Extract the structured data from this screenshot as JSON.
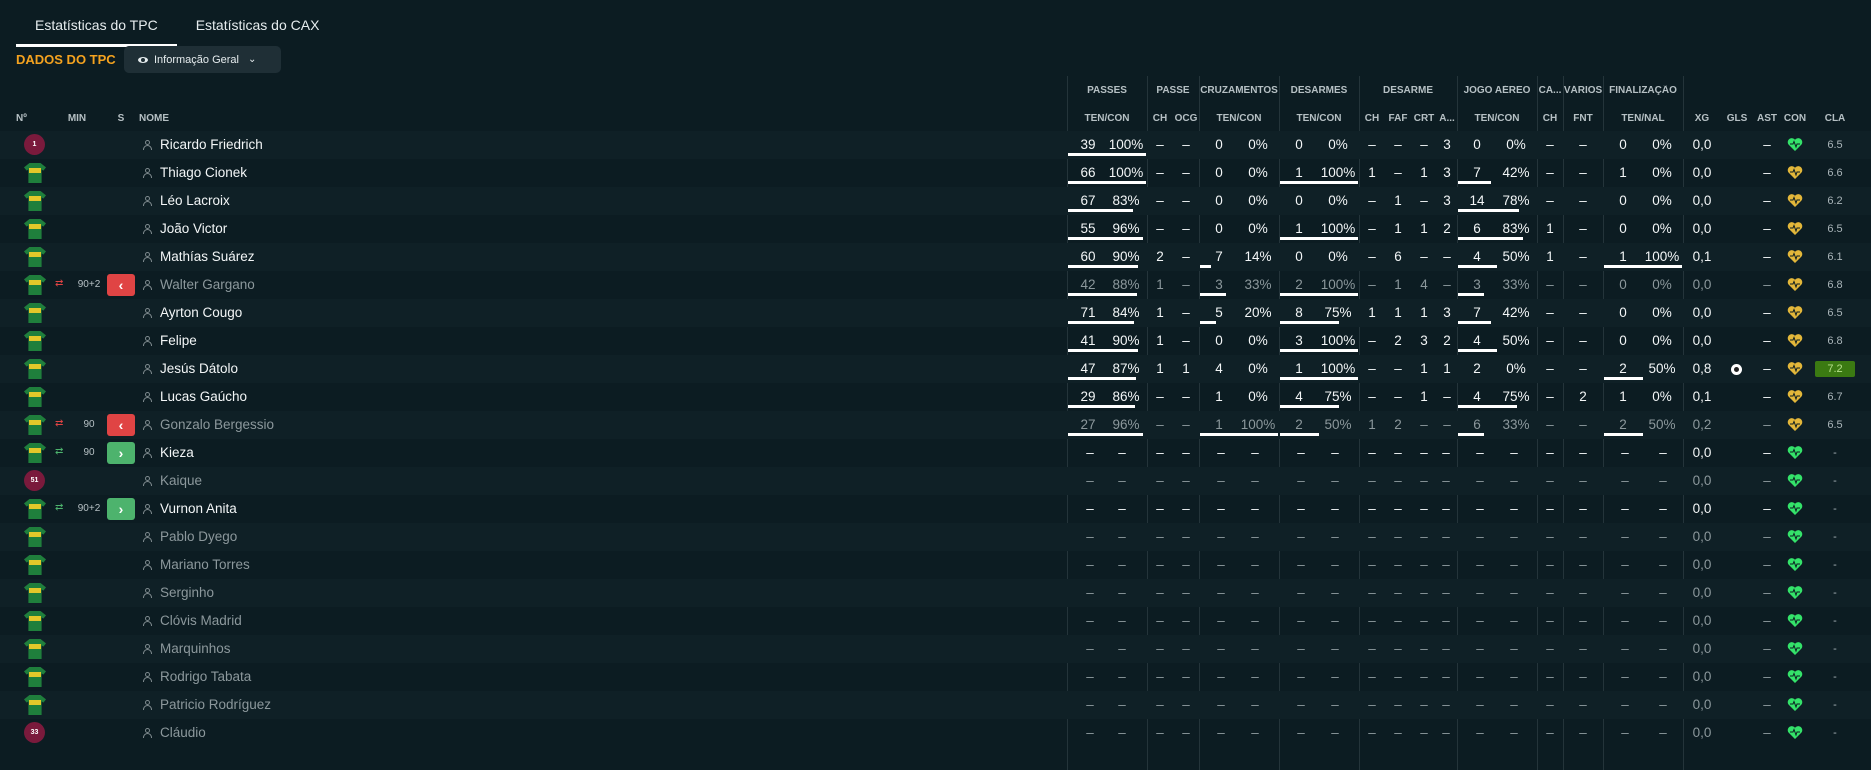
{
  "tabs": [
    {
      "label": "Estatísticas do TPC",
      "active": true
    },
    {
      "label": "Estatísticas do CAX",
      "active": false
    }
  ],
  "section_title": "DADOS DO TPC",
  "view_dropdown": {
    "label": "Informação Geral"
  },
  "groups": [
    "PASSES",
    "PASSE",
    "CRUZAMENTOS",
    "DESARMES",
    "DESARME",
    "JOGO AÉREO",
    "CA...",
    "VÁRIOS",
    "FINALIZAÇÃO"
  ],
  "headers": {
    "num": "Nº",
    "min": "MIN",
    "s": "S",
    "name": "NOME",
    "pass": "TEN/CON",
    "pass_ch": "CH",
    "pass_ocg": "OCG",
    "cross": "TEN/CON",
    "tackle": "TEN/CON",
    "tk_ch": "CH",
    "tk_faf": "FAF",
    "tk_crt": "CRT",
    "tk_a": "A...",
    "air": "TEN/CON",
    "ca_ch": "CH",
    "var_fnt": "FNT",
    "fin": "TEN/NAL",
    "xg": "XG",
    "gls": "GLS",
    "ast": "AST",
    "con": "CON",
    "cla": "CLA"
  },
  "colors": {
    "accent": "#f4a21f",
    "out": "#e04444",
    "in": "#4db36d",
    "heart_green": "#34e36a",
    "heart_gold": "#e3b73a"
  },
  "players": [
    {
      "name": "Ricardo Friedrich",
      "kit": "gk",
      "num": "1",
      "dim": false,
      "sub": null,
      "min": "",
      "pass": [
        "39",
        "100%"
      ],
      "pass_bar": 1.0,
      "pch": "–",
      "pocg": "–",
      "cross": [
        "0",
        "0%"
      ],
      "cross_bar": 0,
      "tack": [
        "0",
        "0%"
      ],
      "tack_bar": 0,
      "tk": [
        "–",
        "–",
        "–",
        "3"
      ],
      "air": [
        "0",
        "0%"
      ],
      "air_bar": 0,
      "cach": "–",
      "fnt": "–",
      "fin": [
        "0",
        "0%"
      ],
      "fin_bar": 0,
      "xg": "0,0",
      "gls": "",
      "ast": "–",
      "con": "green",
      "cla": "6.5",
      "cla_hi": false
    },
    {
      "name": "Thiago Cionek",
      "kit": "green",
      "num": "",
      "dim": false,
      "sub": null,
      "min": "",
      "pass": [
        "66",
        "100%"
      ],
      "pass_bar": 1.0,
      "pch": "–",
      "pocg": "–",
      "cross": [
        "0",
        "0%"
      ],
      "cross_bar": 0,
      "tack": [
        "1",
        "100%"
      ],
      "tack_bar": 1.0,
      "tk": [
        "1",
        "–",
        "1",
        "3"
      ],
      "air": [
        "7",
        "42%"
      ],
      "air_bar": 0.42,
      "cach": "–",
      "fnt": "–",
      "fin": [
        "1",
        "0%"
      ],
      "fin_bar": 0,
      "xg": "0,0",
      "gls": "",
      "ast": "–",
      "con": "gold",
      "cla": "6.6",
      "cla_hi": false
    },
    {
      "name": "Léo Lacroix",
      "kit": "green",
      "num": "",
      "dim": false,
      "sub": null,
      "min": "",
      "pass": [
        "67",
        "83%"
      ],
      "pass_bar": 0.83,
      "pch": "–",
      "pocg": "–",
      "cross": [
        "0",
        "0%"
      ],
      "cross_bar": 0,
      "tack": [
        "0",
        "0%"
      ],
      "tack_bar": 0,
      "tk": [
        "–",
        "1",
        "–",
        "3"
      ],
      "air": [
        "14",
        "78%"
      ],
      "air_bar": 0.78,
      "cach": "–",
      "fnt": "–",
      "fin": [
        "0",
        "0%"
      ],
      "fin_bar": 0,
      "xg": "0,0",
      "gls": "",
      "ast": "–",
      "con": "gold",
      "cla": "6.2",
      "cla_hi": false
    },
    {
      "name": "João Victor",
      "kit": "green",
      "num": "",
      "dim": false,
      "sub": null,
      "min": "",
      "pass": [
        "55",
        "96%"
      ],
      "pass_bar": 0.96,
      "pch": "–",
      "pocg": "–",
      "cross": [
        "0",
        "0%"
      ],
      "cross_bar": 0,
      "tack": [
        "1",
        "100%"
      ],
      "tack_bar": 1.0,
      "tk": [
        "–",
        "1",
        "1",
        "2"
      ],
      "air": [
        "6",
        "83%"
      ],
      "air_bar": 0.83,
      "cach": "1",
      "fnt": "–",
      "fin": [
        "0",
        "0%"
      ],
      "fin_bar": 0,
      "xg": "0,0",
      "gls": "",
      "ast": "–",
      "con": "gold",
      "cla": "6.5",
      "cla_hi": false
    },
    {
      "name": "Mathías Suárez",
      "kit": "green",
      "num": "",
      "dim": false,
      "sub": null,
      "min": "",
      "pass": [
        "60",
        "90%"
      ],
      "pass_bar": 0.9,
      "pch": "2",
      "pocg": "–",
      "cross": [
        "7",
        "14%"
      ],
      "cross_bar": 0.14,
      "tack": [
        "0",
        "0%"
      ],
      "tack_bar": 0,
      "tk": [
        "–",
        "6",
        "–",
        "–"
      ],
      "air": [
        "4",
        "50%"
      ],
      "air_bar": 0.5,
      "cach": "1",
      "fnt": "–",
      "fin": [
        "1",
        "100%"
      ],
      "fin_bar": 1.0,
      "xg": "0,1",
      "gls": "",
      "ast": "–",
      "con": "gold",
      "cla": "6.1",
      "cla_hi": false
    },
    {
      "name": "Walter Gargano",
      "kit": "green",
      "num": "",
      "dim": true,
      "sub": "out",
      "min": "90+2",
      "pass": [
        "42",
        "88%"
      ],
      "pass_bar": 0.88,
      "pch": "1",
      "pocg": "–",
      "cross": [
        "3",
        "33%"
      ],
      "cross_bar": 0.33,
      "tack": [
        "2",
        "100%"
      ],
      "tack_bar": 1.0,
      "tk": [
        "–",
        "1",
        "4",
        "–"
      ],
      "air": [
        "3",
        "33%"
      ],
      "air_bar": 0.33,
      "cach": "–",
      "fnt": "–",
      "fin": [
        "0",
        "0%"
      ],
      "fin_bar": 0,
      "xg": "0,0",
      "gls": "",
      "ast": "–",
      "con": "gold",
      "cla": "6.8",
      "cla_hi": false
    },
    {
      "name": "Ayrton Cougo",
      "kit": "green",
      "num": "",
      "dim": false,
      "sub": null,
      "min": "",
      "pass": [
        "71",
        "84%"
      ],
      "pass_bar": 0.84,
      "pch": "1",
      "pocg": "–",
      "cross": [
        "5",
        "20%"
      ],
      "cross_bar": 0.2,
      "tack": [
        "8",
        "75%"
      ],
      "tack_bar": 0.75,
      "tk": [
        "1",
        "1",
        "1",
        "3"
      ],
      "air": [
        "7",
        "42%"
      ],
      "air_bar": 0.42,
      "cach": "–",
      "fnt": "–",
      "fin": [
        "0",
        "0%"
      ],
      "fin_bar": 0,
      "xg": "0,0",
      "gls": "",
      "ast": "–",
      "con": "gold",
      "cla": "6.5",
      "cla_hi": false
    },
    {
      "name": "Felipe",
      "kit": "green",
      "num": "",
      "dim": false,
      "sub": null,
      "min": "",
      "pass": [
        "41",
        "90%"
      ],
      "pass_bar": 0.9,
      "pch": "1",
      "pocg": "–",
      "cross": [
        "0",
        "0%"
      ],
      "cross_bar": 0,
      "tack": [
        "3",
        "100%"
      ],
      "tack_bar": 1.0,
      "tk": [
        "–",
        "2",
        "3",
        "2"
      ],
      "air": [
        "4",
        "50%"
      ],
      "air_bar": 0.5,
      "cach": "–",
      "fnt": "–",
      "fin": [
        "0",
        "0%"
      ],
      "fin_bar": 0,
      "xg": "0,0",
      "gls": "",
      "ast": "–",
      "con": "gold",
      "cla": "6.8",
      "cla_hi": false
    },
    {
      "name": "Jesús Dátolo",
      "kit": "green",
      "num": "",
      "dim": false,
      "sub": null,
      "min": "",
      "pass": [
        "47",
        "87%"
      ],
      "pass_bar": 0.87,
      "pch": "1",
      "pocg": "1",
      "cross": [
        "4",
        "0%"
      ],
      "cross_bar": 0,
      "tack": [
        "1",
        "100%"
      ],
      "tack_bar": 1.0,
      "tk": [
        "–",
        "–",
        "1",
        "1"
      ],
      "air": [
        "2",
        "0%"
      ],
      "air_bar": 0,
      "cach": "–",
      "fnt": "–",
      "fin": [
        "2",
        "50%"
      ],
      "fin_bar": 0.5,
      "xg": "0,8",
      "gls": "ball",
      "ast": "–",
      "con": "gold",
      "cla": "7.2",
      "cla_hi": true
    },
    {
      "name": "Lucas Gaúcho",
      "kit": "green",
      "num": "",
      "dim": false,
      "sub": null,
      "min": "",
      "pass": [
        "29",
        "86%"
      ],
      "pass_bar": 0.86,
      "pch": "–",
      "pocg": "–",
      "cross": [
        "1",
        "0%"
      ],
      "cross_bar": 0,
      "tack": [
        "4",
        "75%"
      ],
      "tack_bar": 0.75,
      "tk": [
        "–",
        "–",
        "1",
        "–"
      ],
      "air": [
        "4",
        "75%"
      ],
      "air_bar": 0.75,
      "cach": "–",
      "fnt": "2",
      "fin": [
        "1",
        "0%"
      ],
      "fin_bar": 0,
      "xg": "0,1",
      "gls": "",
      "ast": "–",
      "con": "gold",
      "cla": "6.7",
      "cla_hi": false
    },
    {
      "name": "Gonzalo Bergessio",
      "kit": "green",
      "num": "",
      "dim": true,
      "sub": "out",
      "min": "90",
      "pass": [
        "27",
        "96%"
      ],
      "pass_bar": 0.96,
      "pch": "–",
      "pocg": "–",
      "cross": [
        "1",
        "100%"
      ],
      "cross_bar": 1.0,
      "tack": [
        "2",
        "50%"
      ],
      "tack_bar": 0.5,
      "tk": [
        "1",
        "2",
        "–",
        "–"
      ],
      "air": [
        "6",
        "33%"
      ],
      "air_bar": 0.33,
      "cach": "–",
      "fnt": "–",
      "fin": [
        "2",
        "50%"
      ],
      "fin_bar": 0.5,
      "xg": "0,2",
      "gls": "",
      "ast": "–",
      "con": "gold",
      "cla": "6.5",
      "cla_hi": false
    },
    {
      "name": "Kieza",
      "kit": "green",
      "num": "",
      "dim": false,
      "sub": "in",
      "min": "90",
      "empty": true,
      "xg": "0,0",
      "ast": "–",
      "con": "green",
      "cla": "-"
    },
    {
      "name": "Kaique",
      "kit": "gk",
      "num": "51",
      "dim": true,
      "sub": null,
      "min": "",
      "empty": true,
      "xg": "0,0",
      "ast": "–",
      "con": "green",
      "cla": "-"
    },
    {
      "name": "Vurnon Anita",
      "kit": "green",
      "num": "",
      "dim": false,
      "sub": "in",
      "min": "90+2",
      "empty": true,
      "xg": "0,0",
      "ast": "–",
      "con": "green",
      "cla": "-"
    },
    {
      "name": "Pablo Dyego",
      "kit": "green",
      "num": "",
      "dim": true,
      "sub": null,
      "min": "",
      "empty": true,
      "xg": "0,0",
      "ast": "–",
      "con": "green",
      "cla": "-"
    },
    {
      "name": "Mariano Torres",
      "kit": "green",
      "num": "",
      "dim": true,
      "sub": null,
      "min": "",
      "empty": true,
      "xg": "0,0",
      "ast": "–",
      "con": "green",
      "cla": "-"
    },
    {
      "name": "Serginho",
      "kit": "green",
      "num": "",
      "dim": true,
      "sub": null,
      "min": "",
      "empty": true,
      "xg": "0,0",
      "ast": "–",
      "con": "green",
      "cla": "-"
    },
    {
      "name": "Clóvis Madrid",
      "kit": "green",
      "num": "",
      "dim": true,
      "sub": null,
      "min": "",
      "empty": true,
      "xg": "0,0",
      "ast": "–",
      "con": "green",
      "cla": "-"
    },
    {
      "name": "Marquinhos",
      "kit": "green",
      "num": "",
      "dim": true,
      "sub": null,
      "min": "",
      "empty": true,
      "xg": "0,0",
      "ast": "–",
      "con": "green",
      "cla": "-"
    },
    {
      "name": "Rodrigo Tabata",
      "kit": "green",
      "num": "",
      "dim": true,
      "sub": null,
      "min": "",
      "empty": true,
      "xg": "0,0",
      "ast": "–",
      "con": "green",
      "cla": "-"
    },
    {
      "name": "Patricio Rodríguez",
      "kit": "green",
      "num": "",
      "dim": true,
      "sub": null,
      "min": "",
      "empty": true,
      "xg": "0,0",
      "ast": "–",
      "con": "green",
      "cla": "-"
    },
    {
      "name": "Cláudio",
      "kit": "gk",
      "num": "33",
      "dim": true,
      "sub": null,
      "min": "",
      "empty": true,
      "xg": "0,0",
      "ast": "–",
      "con": "green",
      "cla": "-"
    }
  ]
}
